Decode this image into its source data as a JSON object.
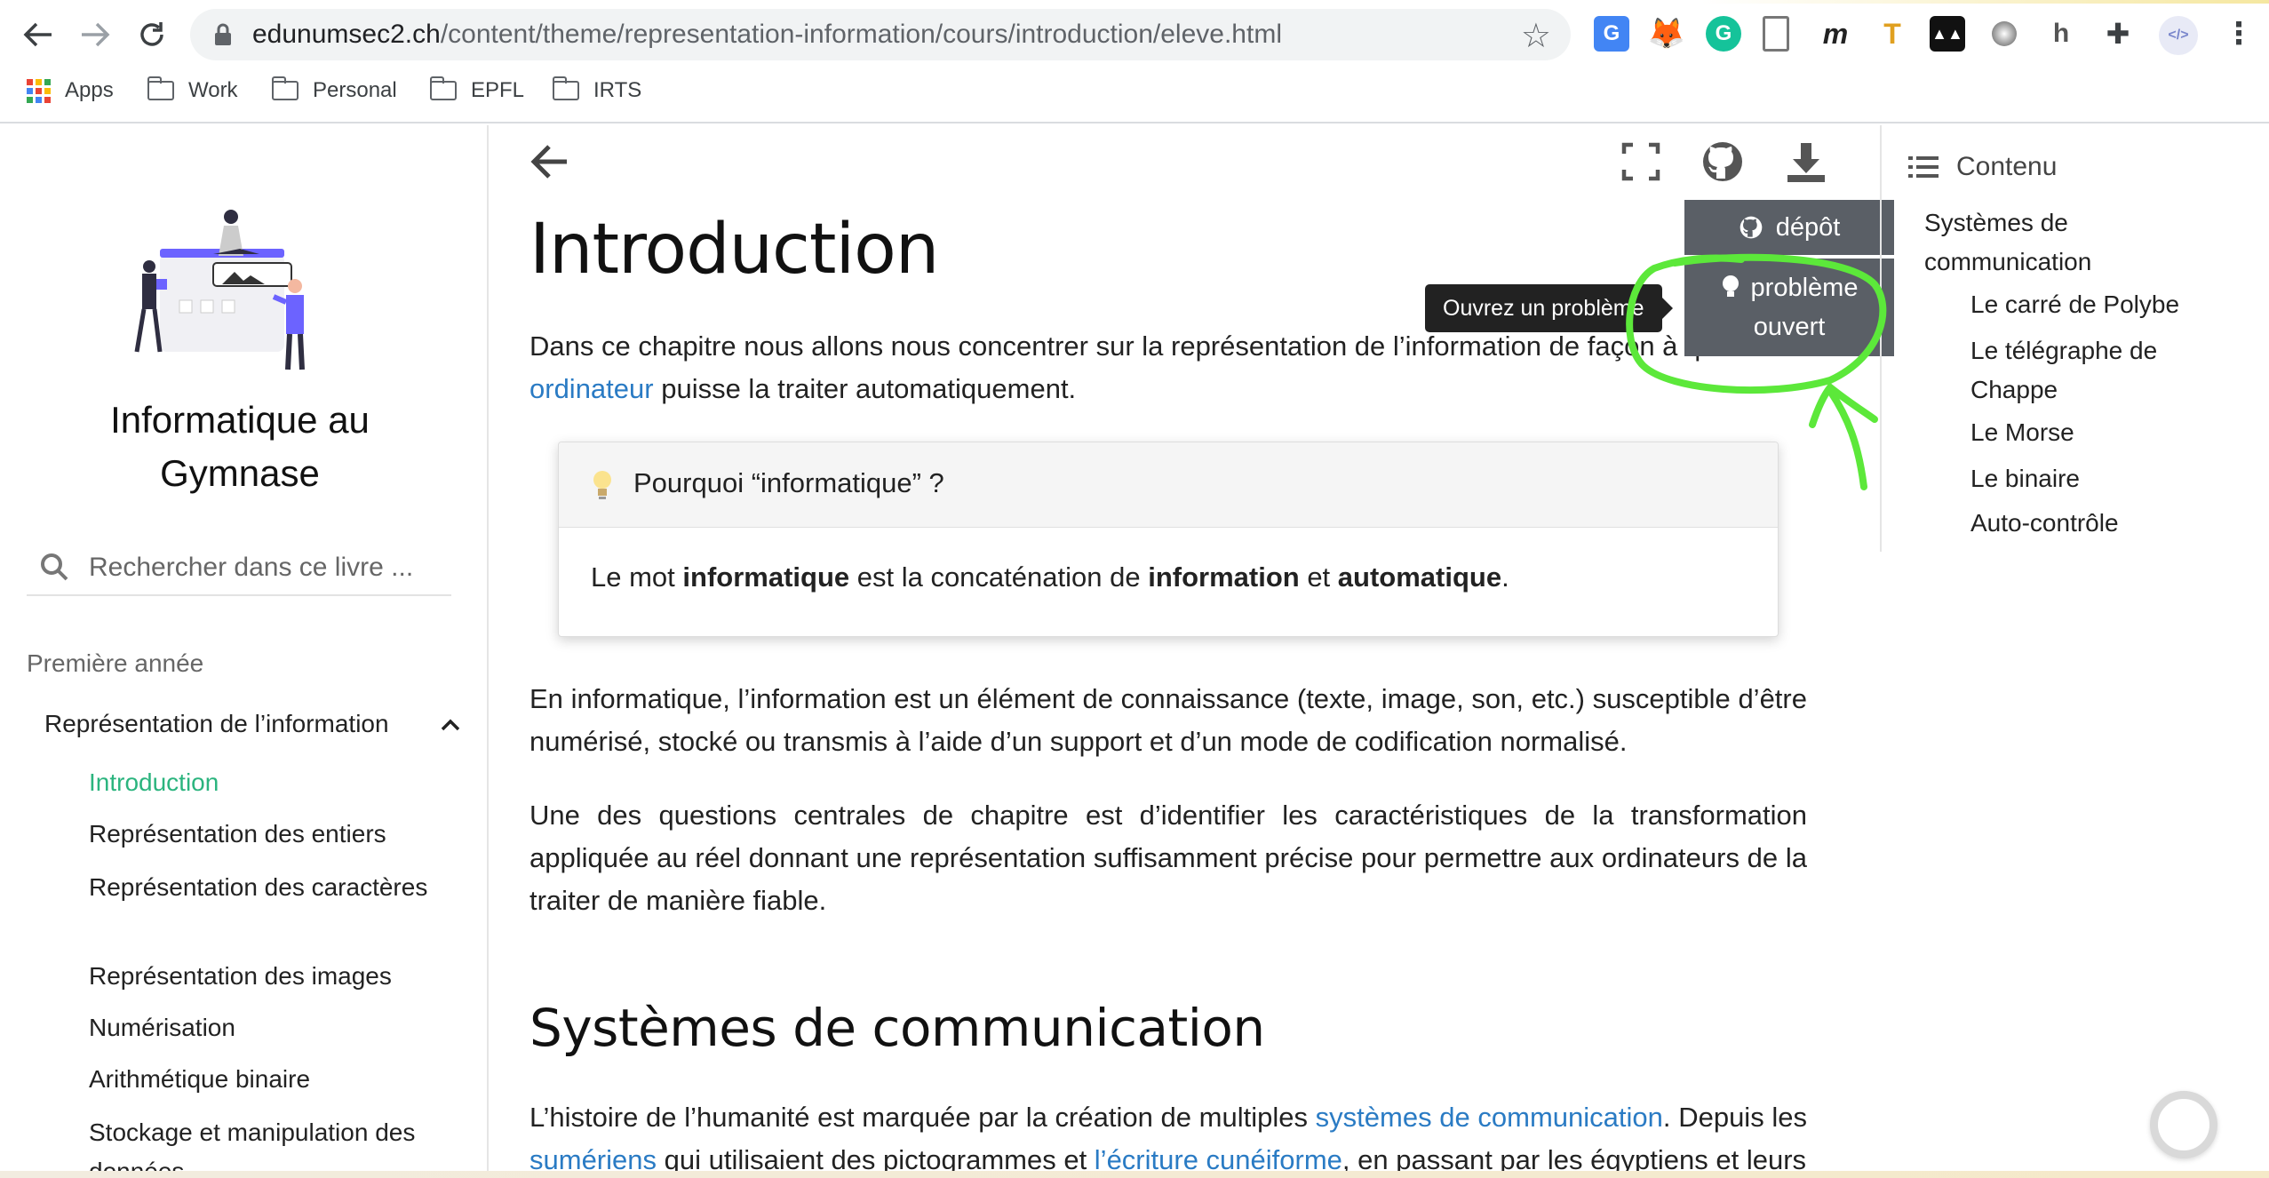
{
  "browser": {
    "url_host": "edunumsec2.ch",
    "url_path": "/content/theme/representation-information/cours/introduction/eleve.html",
    "bookmarks": [
      "Apps",
      "Work",
      "Personal",
      "EPFL",
      "IRTS"
    ],
    "extensions": [
      "google-translate",
      "metamask",
      "grammarly",
      "doc",
      "medium",
      "t",
      "mosaic",
      "circle",
      "h",
      "puzzle",
      "profile"
    ]
  },
  "sidebar": {
    "site_title": "Informatique au Gymnase",
    "search_placeholder": "Rechercher dans ce livre ...",
    "caption": "Première année",
    "section": "Représentation de l’information",
    "items": [
      {
        "label": "Introduction"
      },
      {
        "label": "Représentation des entiers"
      },
      {
        "label": "Représentation des caractères"
      },
      {
        "label": "Représentation des images"
      },
      {
        "label": "Numérisation"
      },
      {
        "label": "Arithmétique binaire"
      },
      {
        "label": "Stockage et manipulation des données"
      }
    ]
  },
  "toolbar": {
    "depot_label": "dépôt",
    "issue_label_1": "problème",
    "issue_label_2": "ouvert",
    "tooltip": "Ouvrez un problème"
  },
  "content": {
    "title": "Introduction",
    "intro_1": "Dans ce chapitre nous allons nous concentrer sur la représentation de l’information de façon à qu’un",
    "intro_link": "ordinateur",
    "intro_2": " puisse la traiter automatiquement.",
    "admonition_title": "Pourquoi “informatique” ?",
    "admon_a": "Le mot ",
    "admon_b": "informatique",
    "admon_c": " est la concaténation de ",
    "admon_d": "information",
    "admon_e": " et ",
    "admon_f": "automatique",
    "admon_g": ".",
    "para2": "En informatique, l’information est un élément de connaissance (texte, image, son, etc.) susceptible d’être numérisé, stocké ou transmis à l’aide d’un support et d’un mode de codification normalisé.",
    "para3": "Une des questions centrales de chapitre est d’identifier les caractéristiques de la transformation appliquée au réel donnant une représentation suffisamment précise pour permettre aux ordinateurs de la traiter de manière fiable.",
    "h2": "Systèmes de communication",
    "para4_a": "L’histoire de l’humanité est marquée par la création de multiples ",
    "para4_link1": "systèmes de communication",
    "para4_b": ". Depuis les ",
    "para4_link2": "sumériens",
    "para4_c": " qui utilisaient des pictogrammes et ",
    "para4_link3": "l’écriture cunéiforme",
    "para4_d": ", en passant par les égyptiens et leurs"
  },
  "toc": {
    "header": "Contenu",
    "items": [
      {
        "label": "Systèmes de communication"
      },
      {
        "label": "Le carré de Polybe"
      },
      {
        "label": "Le télégraphe de Chappe"
      },
      {
        "label": "Le Morse"
      },
      {
        "label": "Le binaire"
      },
      {
        "label": "Auto-contrôle"
      }
    ]
  },
  "colors": {
    "active_nav": "#2bb47e",
    "link": "#2a7bc4",
    "annotation": "#5ce83a",
    "dropdown_bg": "#5a5f66"
  }
}
